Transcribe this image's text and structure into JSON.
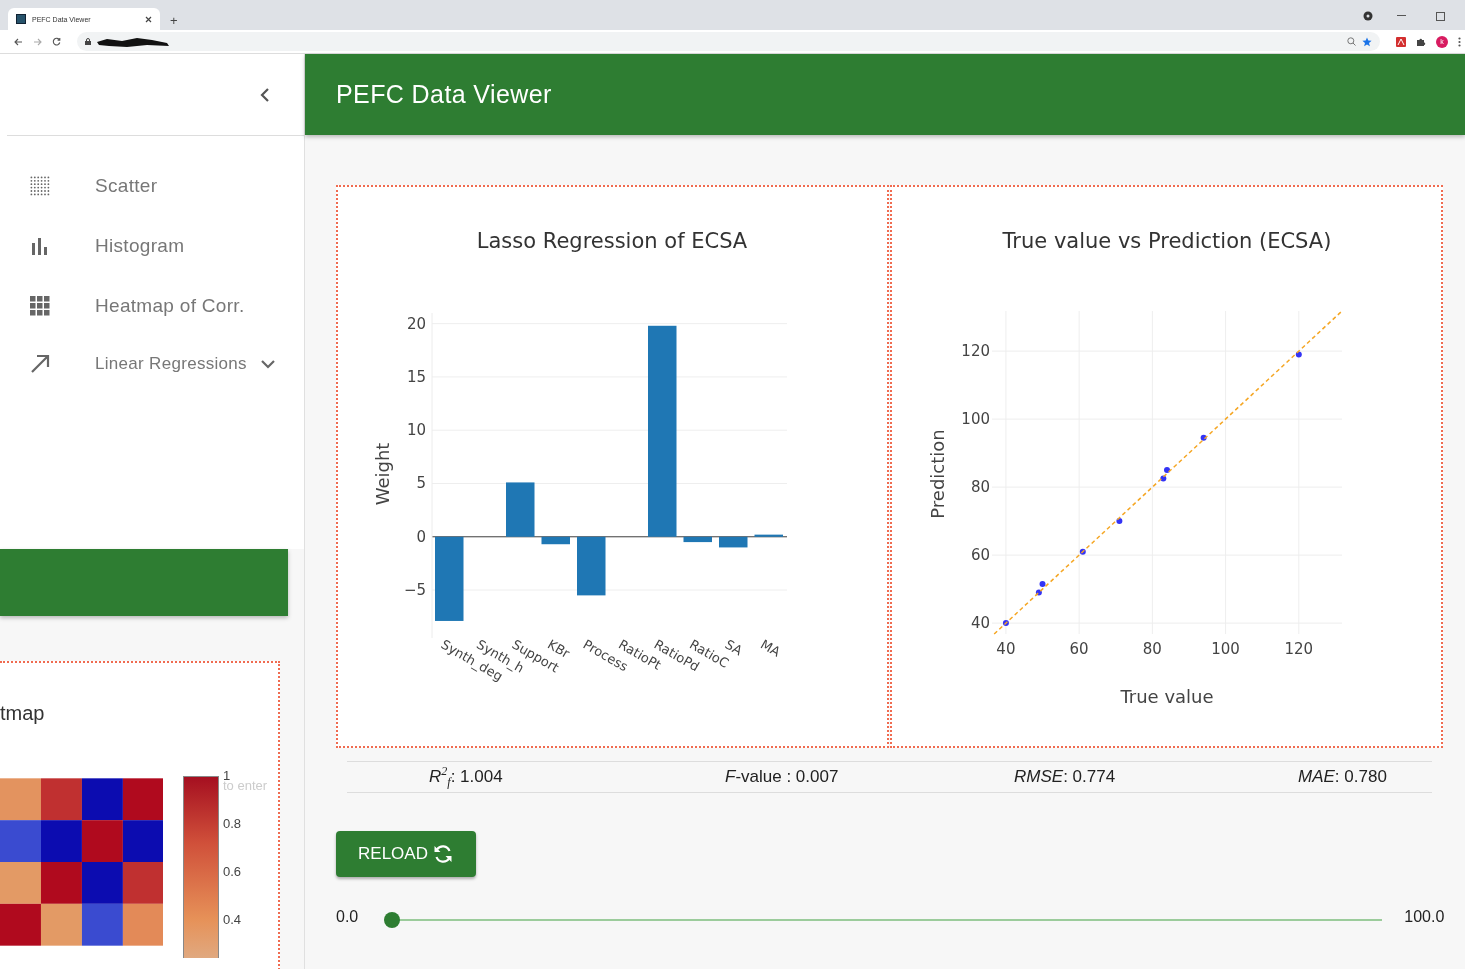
{
  "browser": {
    "tab_title": "PEFC Data Viewer",
    "new_tab": "+",
    "avatar": "k"
  },
  "sidebar": {
    "items": [
      {
        "label": "Scatter",
        "kind": "scatter"
      },
      {
        "label": "Histogram",
        "kind": "histogram"
      },
      {
        "label": "Heatmap of Corr.",
        "kind": "grid"
      },
      {
        "label": "Linear Regressions",
        "kind": "trend",
        "expanded": false
      }
    ]
  },
  "background_page": {
    "card_title": "tmap",
    "hint": "to enter",
    "colorbar_ticks": [
      "1",
      "0.8",
      "0.6",
      "0.4"
    ]
  },
  "header": {
    "title": "PEFC Data Viewer"
  },
  "charts": [
    {
      "chart_data": {
        "type": "bar",
        "title": "Lasso Regression of ECSA",
        "ylabel": "Weight",
        "categories": [
          "Synth_deg",
          "Synth_h",
          "Support",
          "KBr",
          "Process",
          "RatioPt",
          "RatioPd",
          "RatioC",
          "SA",
          "MA"
        ],
        "ylim": [
          -9.5,
          21
        ],
        "yticks": [
          {
            "value": -5,
            "label": "−5"
          },
          0,
          5,
          10,
          15,
          20
        ],
        "grid": true,
        "values": [
          -7.9,
          0,
          5.1,
          -0.7,
          -5.5,
          0,
          19.8,
          -0.5,
          -1.0,
          0.2
        ]
      }
    },
    {
      "chart_data": {
        "type": "scatter",
        "title": "True value vs Prediction (ECSA)",
        "xlabel": "True value",
        "ylabel": "Prediction",
        "x": [
          40,
          49,
          50,
          61,
          71,
          83,
          84,
          94,
          120
        ],
        "xlim": [
          36.2,
          131.8
        ],
        "ylim": [
          36.8,
          131.8
        ],
        "xticks": [
          40,
          60,
          80,
          100,
          120
        ],
        "yticks": [
          40,
          60,
          80,
          100,
          120
        ],
        "grid": true,
        "values": [
          40,
          49,
          51.5,
          61,
          70,
          82.5,
          85,
          94.5,
          119
        ]
      }
    }
  ],
  "metrics": [
    "*R*$^{2}$$_{f}$: 1.004",
    "*F*-value : 0.007",
    "*RMSE*: 0.774",
    "*MAE*: 0.780"
  ],
  "reload_button": {
    "label": "RELOAD"
  },
  "slider": {
    "min_label": "0.0",
    "max_label": "100.0",
    "level": 0
  }
}
